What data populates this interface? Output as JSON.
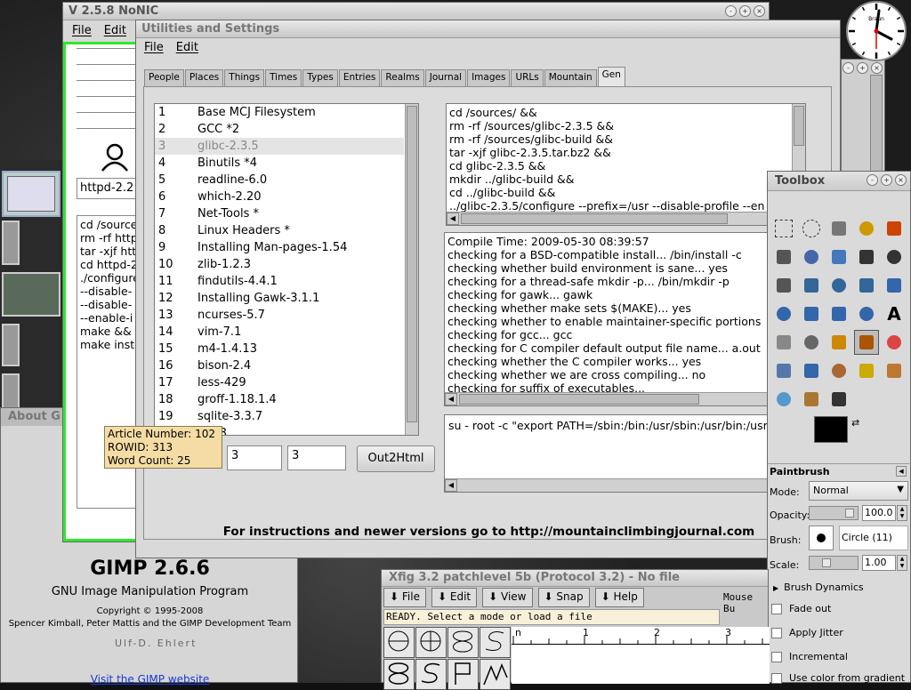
{
  "nonic": {
    "title": "V 2.5.8 NoNIC",
    "menu": [
      "File",
      "Edit"
    ],
    "entry_value": "httpd-2.2",
    "script_lines": [
      "cd /sources",
      "rm -rf http",
      "tar -xjf htt",
      "cd httpd-2",
      "./configure",
      "--disable-",
      "--disable-",
      "--enable-i",
      "make &&",
      "make inst"
    ]
  },
  "utilities": {
    "title": "Utilities and Settings",
    "menu": [
      "File",
      "Edit"
    ],
    "tabs": [
      "People",
      "Places",
      "Things",
      "Times",
      "Types",
      "Entries",
      "Realms",
      "Journal",
      "Images",
      "URLs",
      "Mountain",
      "Gen"
    ],
    "active_tab": "Gen",
    "list": [
      {
        "n": "1",
        "name": "Base MCJ Filesystem"
      },
      {
        "n": "2",
        "name": "GCC *2"
      },
      {
        "n": "3",
        "name": "glibc-2.3.5"
      },
      {
        "n": "4",
        "name": "Binutils *4"
      },
      {
        "n": "5",
        "name": "readline-6.0"
      },
      {
        "n": "6",
        "name": "which-2.20"
      },
      {
        "n": "7",
        "name": "Net-Tools *"
      },
      {
        "n": "8",
        "name": "Linux Headers *"
      },
      {
        "n": "9",
        "name": "Installing Man-pages-1.54"
      },
      {
        "n": "10",
        "name": "zlib-1.2.3"
      },
      {
        "n": "11",
        "name": "findutils-4.4.1"
      },
      {
        "n": "12",
        "name": "Installing Gawk-3.1.1"
      },
      {
        "n": "13",
        "name": "ncurses-5.7"
      },
      {
        "n": "14",
        "name": "vim-7.1"
      },
      {
        "n": "15",
        "name": "m4-1.4.13"
      },
      {
        "n": "16",
        "name": "bison-2.4"
      },
      {
        "n": "17",
        "name": "less-429"
      },
      {
        "n": "18",
        "name": "groff-1.18.1.4"
      },
      {
        "n": "19",
        "name": "sqlite-3.3.7"
      },
      {
        "n": "20",
        "name": "...4.3"
      }
    ],
    "script_lines": [
      "cd /sources/ &&",
      "rm -rf /sources/glibc-2.3.5 &&",
      "rm -rf /sources/glibc-build &&",
      "tar -xjf glibc-2.3.5.tar.bz2 &&",
      "cd glibc-2.3.5 &&",
      "mkdir ../glibc-build &&",
      "cd ../glibc-build &&",
      "../glibc-2.3.5/configure --prefix=/usr --disable-profile --en"
    ],
    "compile_lines": [
      "Compile Time: 2009-05-30 08:39:57",
      "checking for a BSD-compatible install... /bin/install -c",
      "checking whether build environment is sane... yes",
      "checking for a thread-safe mkdir -p... /bin/mkdir -p",
      "checking for gawk... gawk",
      "checking whether make sets $(MAKE)... yes",
      "checking whether to enable maintainer-specific portions",
      "checking for gcc... gcc",
      "checking for C compiler default output file name... a.out",
      "checking whether the C compiler works... yes",
      "checking whether we are cross compiling... no",
      "checking for suffix of executables..."
    ],
    "command": "su - root -c \"export PATH=/sbin:/bin:/usr/sbin:/usr/bin:/usr",
    "field2": "3",
    "field3": "3",
    "out_button": "Out2Html",
    "footer": "For instructions and newer versions go to http://mountainclimbingjournal.com"
  },
  "tooltip": {
    "line1": "Article Number: 102",
    "line2": "ROWID: 313",
    "line3": "Word Count: 25"
  },
  "gimp_about": {
    "tab_label": "About G",
    "title": "GIMP 2.6.6",
    "subtitle": "GNU Image Manipulation Program",
    "copyright": "Copyright © 1995-2008",
    "authors": "Spencer Kimball, Peter Mattis and the GIMP Development Team",
    "credit_text": "Ulf-D. Ehlert",
    "link": "Visit the GIMP website"
  },
  "toolbox": {
    "title": "Toolbox",
    "tool_name": "Paintbrush",
    "mode_label": "Mode:",
    "mode_value": "Normal",
    "opacity_label": "Opacity:",
    "opacity_value": "100.0",
    "brush_label": "Brush:",
    "brush_value": "Circle (11)",
    "scale_label": "Scale:",
    "scale_value": "1.00",
    "dynamics": "Brush Dynamics",
    "options": [
      "Fade out",
      "Apply Jitter",
      "Incremental",
      "Use color from gradient"
    ]
  },
  "xfig": {
    "title": "Xfig 3.2 patchlevel 5b (Protocol 3.2) - No file",
    "menu": [
      "File",
      "Edit",
      "View",
      "Snap",
      "Help"
    ],
    "mouse_label": "Mouse Bu",
    "status": "READY. Select a mode or load a file",
    "ruler": [
      "n",
      "1",
      "2",
      "3"
    ]
  },
  "clock": {
    "label": "Braun"
  }
}
